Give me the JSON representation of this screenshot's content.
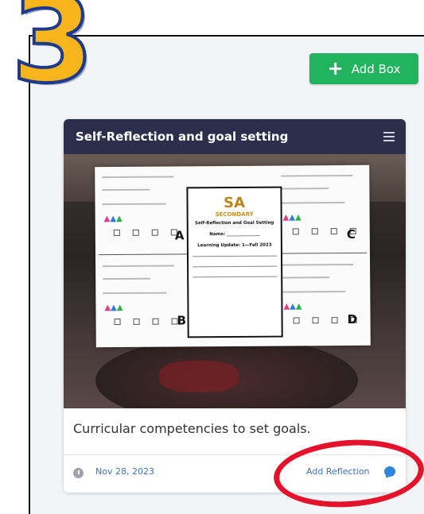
{
  "step_number": "3",
  "toolbar": {
    "add_box_label": "Add Box"
  },
  "card": {
    "title": "Self-Reflection and goal setting",
    "caption": "Curricular competencies to set goals.",
    "date": "Nov 28, 2023",
    "add_reflection_label": "Add Reflection",
    "photo": {
      "quadrant_labels": [
        "A",
        "B",
        "C",
        "D"
      ],
      "center_logo": "SA",
      "center_school": "SECONDARY",
      "center_title": "Self-Reflection and Goal Setting",
      "center_name_label": "Name: _______________",
      "center_update": "Learning Update: 1—Fall 2023"
    }
  },
  "colors": {
    "header_bg": "#2b2f4b",
    "add_button": "#22b35e",
    "link": "#3b73c7",
    "highlight": "#e4122b",
    "badge_fill": "#f6b51c",
    "badge_stroke": "#1e3a8a"
  },
  "icons": {
    "add": "plus-icon",
    "menu": "hamburger-icon",
    "date": "clock-icon",
    "reflection": "chat-bubble-icon"
  }
}
